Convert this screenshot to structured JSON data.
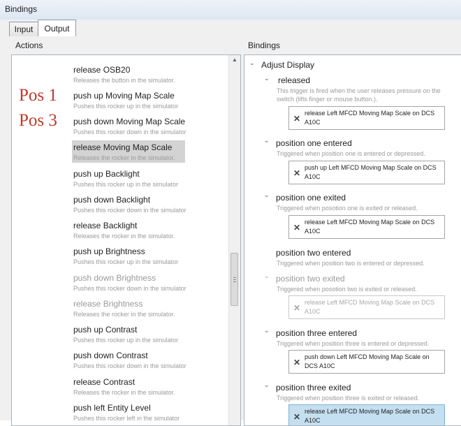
{
  "window": {
    "title": "Bindings"
  },
  "tabs": [
    {
      "label": "Input"
    },
    {
      "label": "Output"
    }
  ],
  "actions_panel": {
    "header": "Actions",
    "items": [
      {
        "name": "release OSB20",
        "desc": "Releases the button in the simulator."
      },
      {
        "name": "push up Moving Map Scale",
        "desc": "Pushes this rocker up in the simulator"
      },
      {
        "name": "push down Moving Map Scale",
        "desc": "Pushes this rocker down in the simulator"
      },
      {
        "name": "release Moving Map Scale",
        "desc": "Releases the rocker in the simulator."
      },
      {
        "name": "push up Backlight",
        "desc": "Pushes this rocker up in the simulator"
      },
      {
        "name": "push down Backlight",
        "desc": "Pushes this rocker down in the simulator"
      },
      {
        "name": "release Backlight",
        "desc": "Releases the rocker in the simulator."
      },
      {
        "name": "push up Brightness",
        "desc": "Pushes this rocker up in the simulator"
      },
      {
        "name": "push down Brightness",
        "desc": "Pushes this rocker down in the simulator"
      },
      {
        "name": "release Brightness",
        "desc": "Releases the rocker in the simulator."
      },
      {
        "name": "push up Contrast",
        "desc": "Pushes this rocker up in the simulator"
      },
      {
        "name": "push down Contrast",
        "desc": "Pushes this rocker down in the simulator"
      },
      {
        "name": "release Contrast",
        "desc": "Releases the rocker in the simulator."
      },
      {
        "name": "push left Entity Level",
        "desc": "Pushes this rocker left in the simulator"
      }
    ],
    "selected_index": 3
  },
  "annotations": {
    "pos1": "Pos 1",
    "pos3": "Pos 3",
    "color": "#c0392b"
  },
  "bindings_panel": {
    "header": "Bindings",
    "root": "Adjust Display",
    "triggers": [
      {
        "name": "released",
        "desc": "This trigger is fired when the user releases pressure on the switch (lifts finger or mouse button.).",
        "binding": "release Left MFCD Moving Map Scale on DCS A10C"
      },
      {
        "name": "position one entered",
        "desc": "Triggered when position one is entered or depressed.",
        "binding": "push up Left MFCD Moving Map Scale on DCS A10C"
      },
      {
        "name": "position one exited",
        "desc": "Triggered when posotion one is exited or released.",
        "binding": "release Left MFCD Moving Map Scale on DCS A10C"
      },
      {
        "name": "position two entered",
        "desc": "Triggered when position two is entered or depressed.",
        "binding": ""
      },
      {
        "name": "position two exited",
        "desc": "Triggered when posotion two is exited or released.",
        "binding": "release Left MFCD Moving Map Scale on DCS A10C"
      },
      {
        "name": "position three entered",
        "desc": "Triggered when position three is entered or depressed.",
        "binding": "push down Left MFCD Moving Map Scale on DCS A10C"
      },
      {
        "name": "position three exited",
        "desc": "Triggered when position three is exited or released.",
        "binding": "release Left MFCD Moving Map Scale on DCS A10C"
      }
    ]
  }
}
